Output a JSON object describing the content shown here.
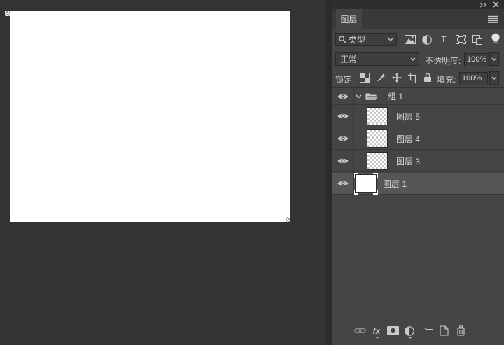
{
  "colors": {
    "app_bg": "#333333",
    "panel_bg": "#454545",
    "selected_row": "#565656",
    "canvas": "#ffffff"
  },
  "panel": {
    "tab": "图层",
    "filter_row": {
      "type_filter_value": "类型",
      "type_glyph": "T"
    },
    "blend_row": {
      "mode_value": "正常",
      "opacity_label": "不透明度:",
      "opacity_value": "100%"
    },
    "lock_row": {
      "lock_label": "锁定:",
      "fill_label": "填充:",
      "fill_value": "100%"
    },
    "layers": [
      {
        "kind": "group",
        "name": "组 1",
        "expanded": true,
        "visible": true
      },
      {
        "kind": "layer",
        "name": "图层 5",
        "thumbnail": "transparent",
        "visible": true
      },
      {
        "kind": "layer",
        "name": "图层 4",
        "thumbnail": "transparent",
        "visible": true
      },
      {
        "kind": "layer",
        "name": "图层 3",
        "thumbnail": "transparent",
        "visible": true
      },
      {
        "kind": "layer",
        "name": "图层 1",
        "thumbnail": "white",
        "visible": true,
        "selected": true
      }
    ],
    "bottom_bar": {
      "fx_label": "fx"
    }
  }
}
